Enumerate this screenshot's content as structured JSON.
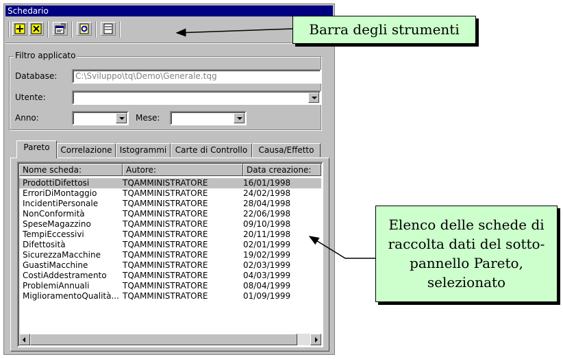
{
  "window": {
    "title": "Schedario"
  },
  "toolbar": {
    "buttons": [
      {
        "icon": "add-icon"
      },
      {
        "icon": "delete-icon"
      },
      {
        "icon": "properties-icon"
      },
      {
        "icon": "refresh-icon"
      },
      {
        "icon": "view-icon"
      }
    ]
  },
  "filter": {
    "title": "Filtro applicato",
    "database_label": "Database:",
    "database_value": "C:\\Sviluppo\\tq\\Demo\\Generale.tqg",
    "utente_label": "Utente:",
    "utente_value": "",
    "anno_label": "Anno:",
    "anno_value": "",
    "mese_label": "Mese:",
    "mese_value": ""
  },
  "tabs": [
    {
      "label": "Pareto",
      "active": true
    },
    {
      "label": "Correlazione"
    },
    {
      "label": "Istogrammi"
    },
    {
      "label": "Carte di Controllo"
    },
    {
      "label": "Causa/Effetto"
    }
  ],
  "list": {
    "columns": [
      "Nome scheda:",
      "Autore:",
      "Data creazione:"
    ],
    "rows": [
      [
        "ProdottiDifettosi",
        "TQAMMINISTRATORE",
        "16/01/1998"
      ],
      [
        "ErroriDiMontaggio",
        "TQAMMINISTRATORE",
        "24/02/1998"
      ],
      [
        "IncidentiPersonale",
        "TQAMMINISTRATORE",
        "28/04/1998"
      ],
      [
        "NonConformità",
        "TQAMMINISTRATORE",
        "22/06/1998"
      ],
      [
        "SpeseMagazzino",
        "TQAMMINISTRATORE",
        "09/10/1998"
      ],
      [
        "TempiEccessivi",
        "TQAMMINISTRATORE",
        "20/11/1998"
      ],
      [
        "Difettosità",
        "TQAMMINISTRATORE",
        "02/01/1999"
      ],
      [
        "SicurezzaMacchine",
        "TQAMMINISTRATORE",
        "19/02/1999"
      ],
      [
        "GuastiMacchine",
        "TQAMMINISTRATORE",
        "02/03/1999"
      ],
      [
        "CostiAddestramento",
        "TQAMMINISTRATORE",
        "04/03/1999"
      ],
      [
        "ProblemiAnnuali",
        "TQAMMINISTRATORE",
        "08/04/1999"
      ],
      [
        "MiglioramentoQualità...",
        "TQAMMINISTRATORE",
        "01/09/1999"
      ]
    ],
    "selected_row": 0
  },
  "callouts": {
    "toolbar": "Barra degli strumenti",
    "list_lines": [
      "Elenco delle schede di",
      "raccolta dati del sotto-",
      "pannello Pareto,",
      "selezionato"
    ]
  },
  "colors": {
    "titlebar": "#000080",
    "callout_bg": "#ccffcc",
    "window_bg": "#c0c0c0"
  }
}
